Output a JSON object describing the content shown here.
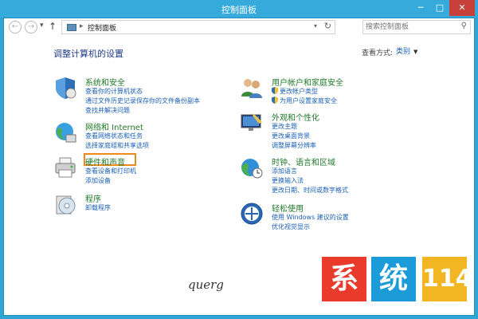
{
  "window": {
    "title": "控制面板",
    "buttons": {
      "minimize": "─",
      "maximize": "□",
      "close": "✕"
    }
  },
  "nav": {
    "back": "←",
    "forward": "→",
    "dropdown": "▾",
    "up": "↑"
  },
  "address": {
    "separator": "▸",
    "path": "控制面板",
    "dropdown": "▾",
    "refresh": "↻"
  },
  "search": {
    "placeholder": "搜索控制面板",
    "icon": "⚲"
  },
  "page": {
    "heading": "调整计算机的设置",
    "view_by_label": "查看方式:",
    "view_by_value": "类别",
    "view_by_caret": "▼"
  },
  "categories": {
    "system": {
      "title": "系统和安全",
      "links": [
        "查看你的计算机状态",
        "通过文件历史记录保存你的文件备份副本",
        "查找并解决问题"
      ]
    },
    "network": {
      "title": "网络和 Internet",
      "links": [
        "查看网络状态和任务",
        "选择家庭组和共享选项"
      ]
    },
    "hardware": {
      "title": "硬件和声音",
      "links": [
        "查看设备和打印机",
        "添加设备"
      ]
    },
    "programs": {
      "title": "程序",
      "links": [
        "卸载程序"
      ]
    },
    "users": {
      "title": "用户帐户和家庭安全",
      "links": [
        "更改帐户类型",
        "为用户设置家庭安全"
      ]
    },
    "appearance": {
      "title": "外观和个性化",
      "links": [
        "更改主题",
        "更改桌面背景",
        "调整屏幕分辨率"
      ]
    },
    "clock": {
      "title": "时钟、语言和区域",
      "links": [
        "添加语言",
        "更换输入法",
        "更改日期、时间或数字格式"
      ]
    },
    "ease": {
      "title": "轻松使用",
      "links": [
        "使用 Windows 建议的设置",
        "优化视觉显示"
      ]
    }
  },
  "watermark": {
    "signature": "querg",
    "logo": [
      "系",
      "统",
      "114"
    ]
  },
  "colors": {
    "title_bar": "#35aadb",
    "category_title": "#1f7a2a",
    "link": "#1a5fb4",
    "highlight_box": "#f0891b"
  }
}
